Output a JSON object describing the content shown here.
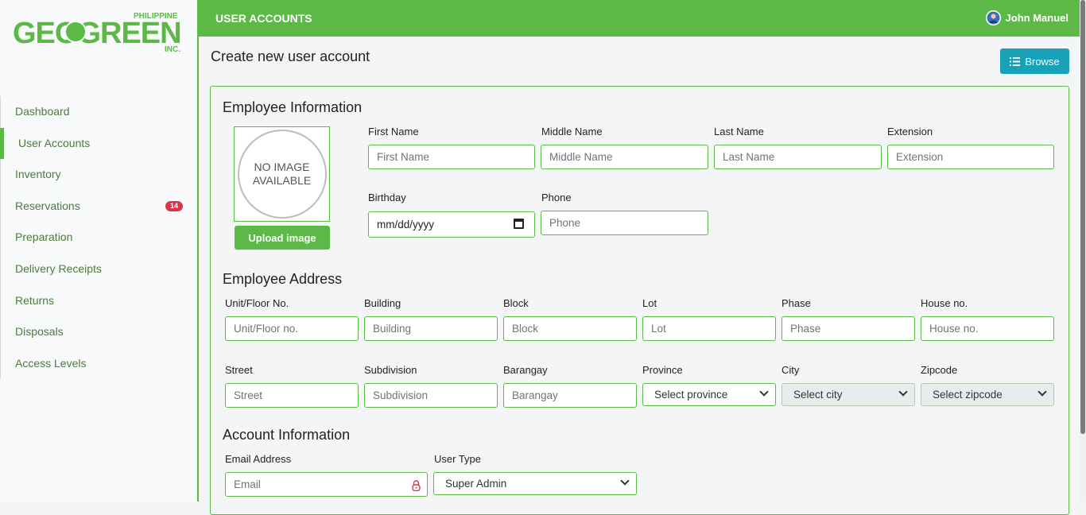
{
  "brand": {
    "prefix": "PHILIPPINE",
    "main": "GEOGREEN",
    "suffix": "INC.",
    "color": "#5cb947"
  },
  "sidebar": {
    "items": [
      {
        "label": "Dashboard"
      },
      {
        "label": "User Accounts",
        "active": true
      },
      {
        "label": "Inventory"
      },
      {
        "label": "Reservations",
        "badge": "14"
      },
      {
        "label": "Preparation"
      },
      {
        "label": "Delivery Receipts"
      },
      {
        "label": "Returns"
      },
      {
        "label": "Disposals"
      },
      {
        "label": "Access Levels"
      }
    ]
  },
  "topbar": {
    "title": "USER ACCOUNTS",
    "user": "John Manuel",
    "avatar_icon": "user-avatar-icon"
  },
  "page": {
    "heading": "Create new user account",
    "browse_label": "Browse"
  },
  "employee_info": {
    "title": "Employee Information",
    "photo_text_1": "NO IMAGE",
    "photo_text_2": "AVAILABLE",
    "upload_label": "Upload image",
    "first_name": {
      "label": "First Name",
      "placeholder": "First Name"
    },
    "middle_name": {
      "label": "Middle Name",
      "placeholder": "Middle Name"
    },
    "last_name": {
      "label": "Last Name",
      "placeholder": "Last Name"
    },
    "extension": {
      "label": "Extension",
      "placeholder": "Extension"
    },
    "birthday": {
      "label": "Birthday",
      "value": "mm/dd/yyyy"
    },
    "phone": {
      "label": "Phone",
      "placeholder": "Phone"
    }
  },
  "address": {
    "title": "Employee Address",
    "unit": {
      "label": "Unit/Floor No.",
      "placeholder": "Unit/Floor no."
    },
    "building": {
      "label": "Building",
      "placeholder": "Building"
    },
    "block": {
      "label": "Block",
      "placeholder": "Block"
    },
    "lot": {
      "label": "Lot",
      "placeholder": "Lot"
    },
    "phase": {
      "label": "Phase",
      "placeholder": "Phase"
    },
    "house": {
      "label": "House no.",
      "placeholder": "House no."
    },
    "street": {
      "label": "Street",
      "placeholder": "Street"
    },
    "subdivision": {
      "label": "Subdivision",
      "placeholder": "Subdivision"
    },
    "barangay": {
      "label": "Barangay",
      "placeholder": "Barangay"
    },
    "province": {
      "label": "Province",
      "value": "Select province"
    },
    "city": {
      "label": "City",
      "value": "Select city"
    },
    "zipcode": {
      "label": "Zipcode",
      "value": "Select zipcode"
    }
  },
  "account": {
    "title": "Account Information",
    "email": {
      "label": "Email Address",
      "placeholder": "Email"
    },
    "user_type": {
      "label": "User Type",
      "value": "Super Admin"
    }
  }
}
